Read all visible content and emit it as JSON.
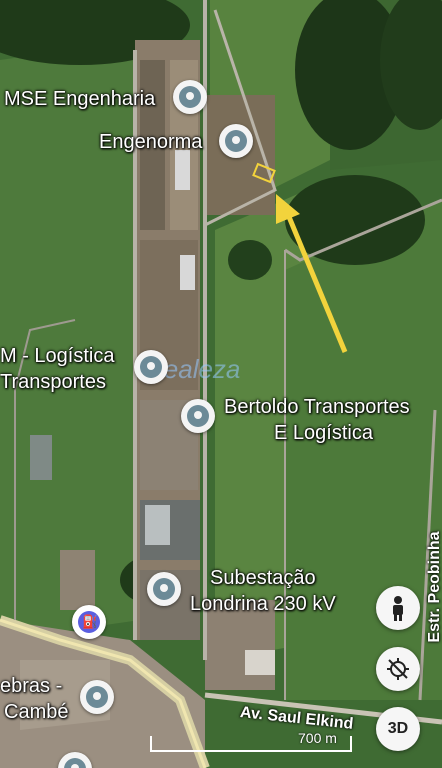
{
  "places": {
    "mse": "MSE Engenharia",
    "engenorma": "Engenorma",
    "logistica_1": "M - Logística",
    "logistica_2": "Transportes",
    "bertoldo_1": "Bertoldo Transportes",
    "bertoldo_2": "E Logística",
    "subestacao_1": "Subestação",
    "subestacao_2": "Londrina 230 kV",
    "cambe_1": "ebras -",
    "cambe_2": "Cambé"
  },
  "roads": {
    "saul_elkind": "Av. Saul Elkind",
    "peobinha": "Estr. Peobinha"
  },
  "controls": {
    "threed": "3D",
    "scale": "700 m"
  },
  "watermark": "Realeza",
  "colors": {
    "arrow": "#f2d33c",
    "pin": "#6c8a97",
    "fuel_pin": "#5a5ee0"
  }
}
